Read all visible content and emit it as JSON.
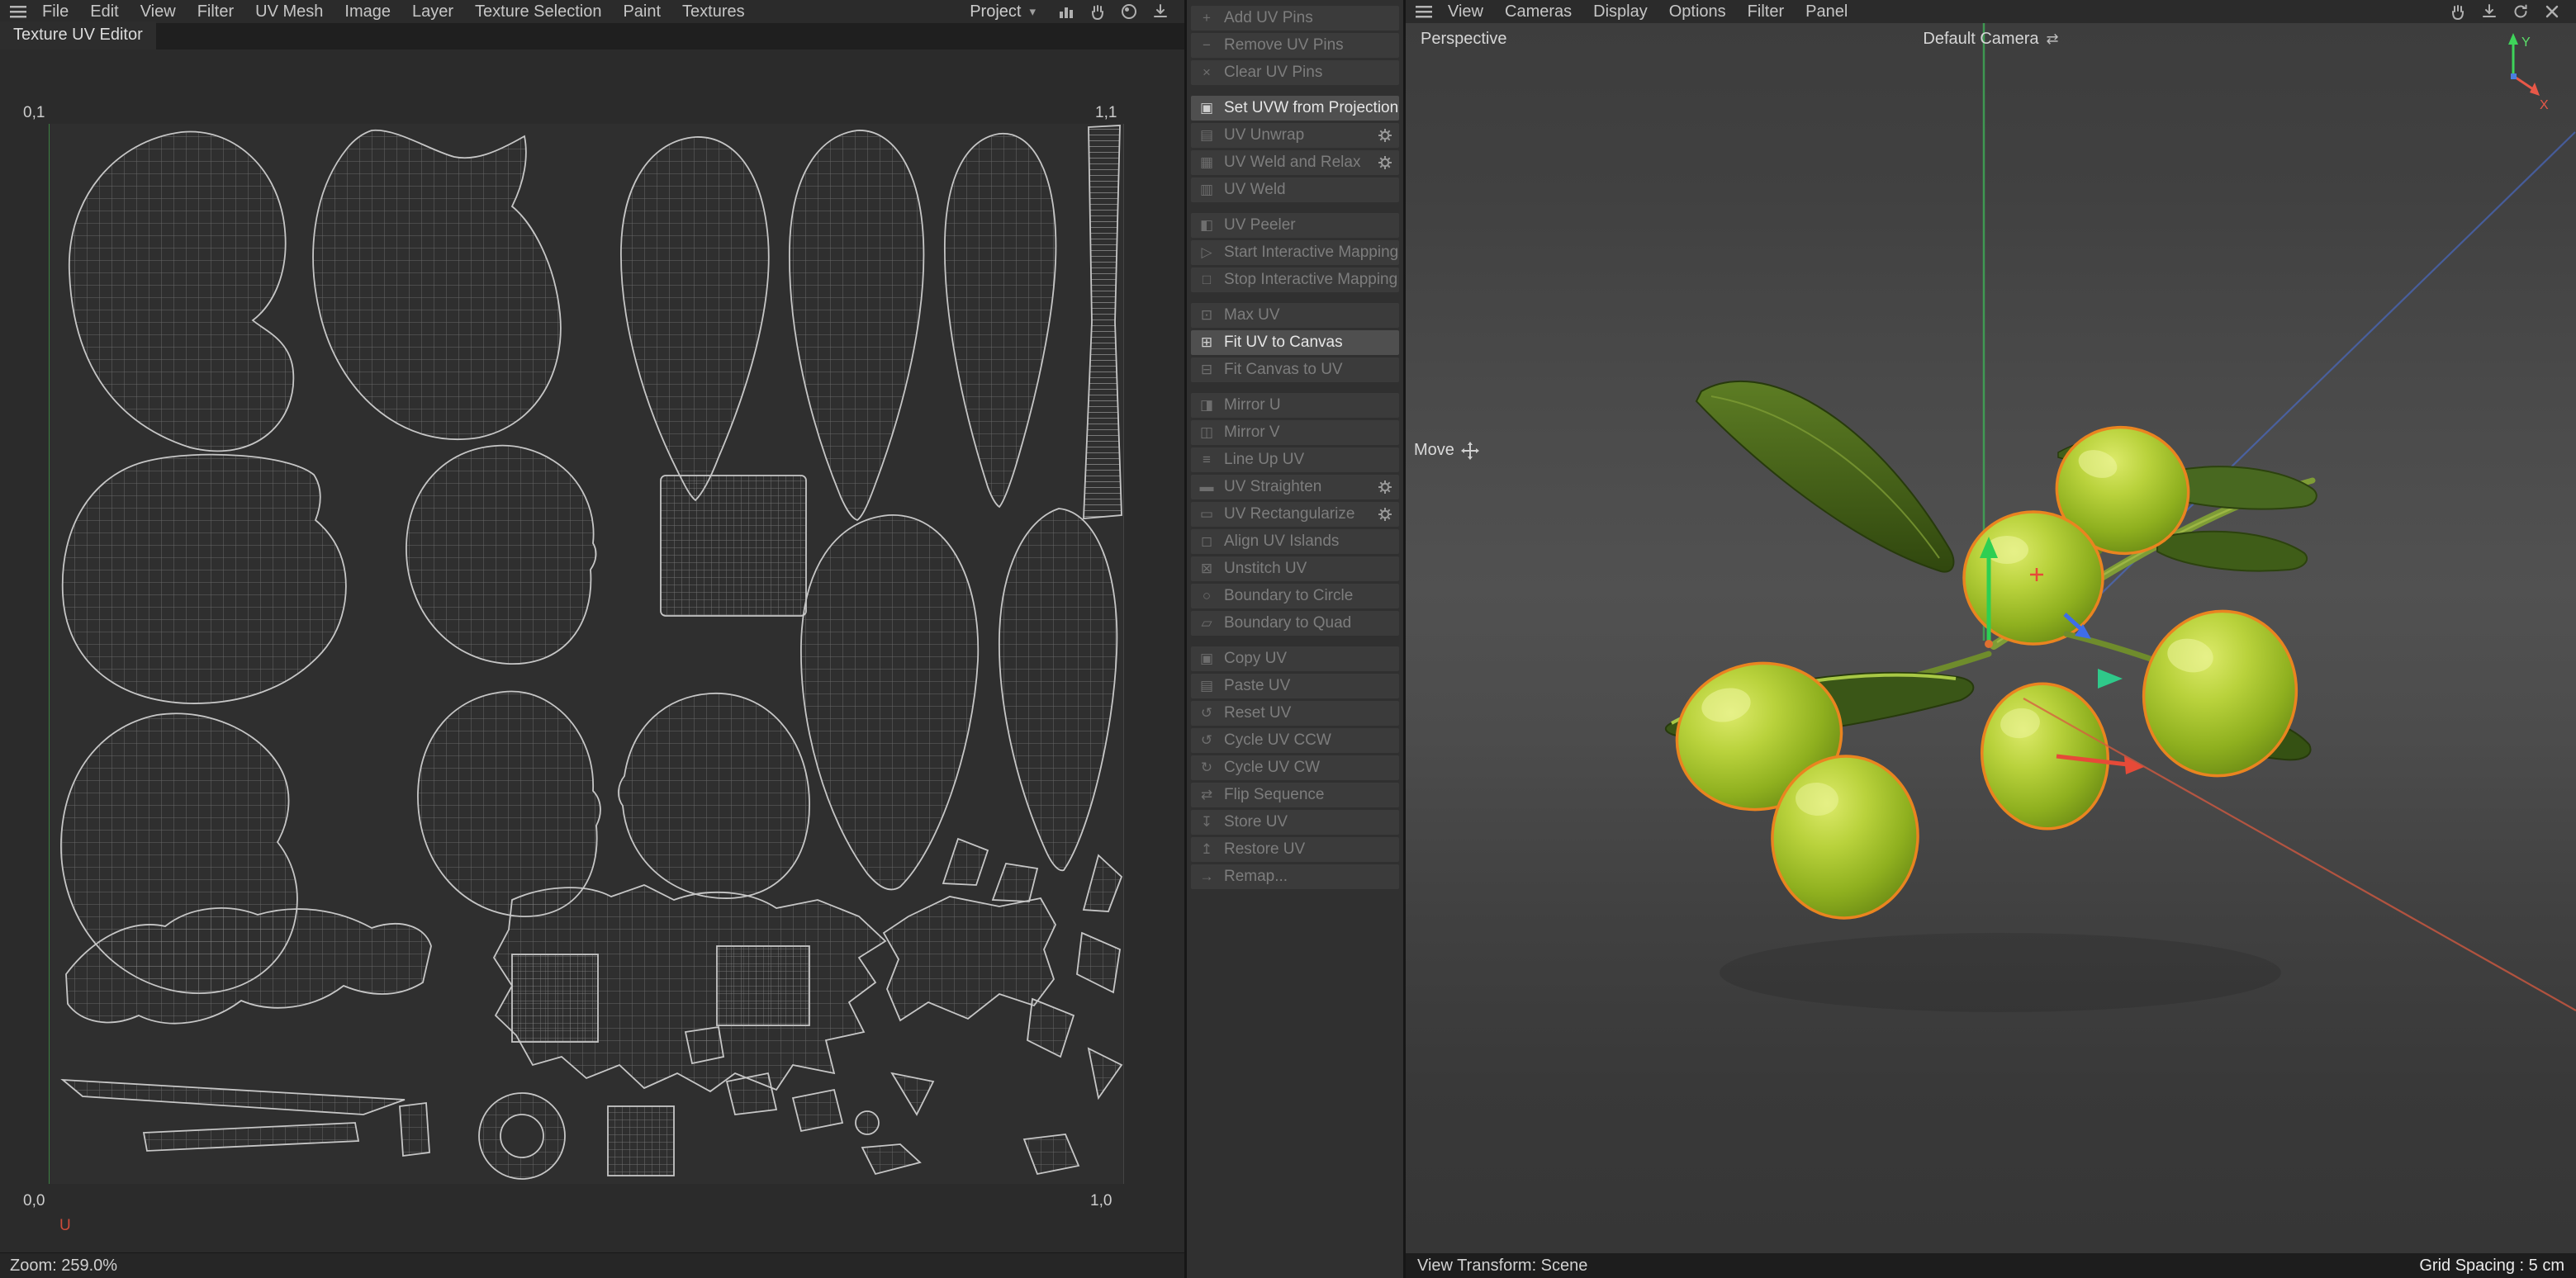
{
  "left_menubar": {
    "items": [
      "File",
      "Edit",
      "View",
      "Filter",
      "UV Mesh",
      "Image",
      "Layer",
      "Texture Selection",
      "Paint",
      "Textures"
    ],
    "project_dropdown": "Project",
    "dropdown_arrow": "▾"
  },
  "right_menubar": {
    "items": [
      "View",
      "Cameras",
      "Display",
      "Options",
      "Filter",
      "Panel"
    ]
  },
  "uv_panel": {
    "tab_title": "Texture UV Editor",
    "corner_top_left": "0,1",
    "corner_top_right": "1,1",
    "corner_bottom_left": "0,0",
    "corner_bottom_right": "1,0",
    "u_axis_label": "U",
    "zoom_status": "Zoom: 259.0%"
  },
  "uv_toolbar": {
    "groups": [
      {
        "items": [
          {
            "label": "Add UV Pins",
            "glyph": "+",
            "enabled": false
          },
          {
            "label": "Remove UV Pins",
            "glyph": "−",
            "enabled": false
          },
          {
            "label": "Clear UV Pins",
            "glyph": "×",
            "enabled": false
          }
        ]
      },
      {
        "items": [
          {
            "label": "Set UVW from Projection",
            "glyph": "▣",
            "enabled": true,
            "highlighted": true,
            "gear": true
          },
          {
            "label": "UV Unwrap",
            "glyph": "▤",
            "enabled": false,
            "gear": true
          },
          {
            "label": "UV Weld and Relax",
            "glyph": "▦",
            "enabled": false,
            "gear": true
          },
          {
            "label": "UV Weld",
            "glyph": "▥",
            "enabled": false
          }
        ]
      },
      {
        "items": [
          {
            "label": "UV Peeler",
            "glyph": "◧",
            "enabled": false
          },
          {
            "label": "Start Interactive Mapping",
            "glyph": "▷",
            "enabled": false
          },
          {
            "label": "Stop Interactive Mapping",
            "glyph": "□",
            "enabled": false
          }
        ]
      },
      {
        "items": [
          {
            "label": "Max UV",
            "glyph": "⊡",
            "enabled": false
          },
          {
            "label": "Fit UV to Canvas",
            "glyph": "⊞",
            "enabled": true,
            "highlighted": true
          },
          {
            "label": "Fit Canvas to UV",
            "glyph": "⊟",
            "enabled": false
          }
        ]
      },
      {
        "items": [
          {
            "label": "Mirror U",
            "glyph": "◨",
            "enabled": false
          },
          {
            "label": "Mirror V",
            "glyph": "◫",
            "enabled": false
          },
          {
            "label": "Line Up UV",
            "glyph": "≡",
            "enabled": false
          },
          {
            "label": "UV Straighten",
            "glyph": "▬",
            "enabled": false,
            "gear": true
          },
          {
            "label": "UV Rectangularize",
            "glyph": "▭",
            "enabled": false,
            "gear": true
          },
          {
            "label": "Align UV Islands",
            "glyph": "◻",
            "enabled": false
          },
          {
            "label": "Unstitch UV",
            "glyph": "⊠",
            "enabled": false
          },
          {
            "label": "Boundary to Circle",
            "glyph": "○",
            "enabled": false
          },
          {
            "label": "Boundary to Quad",
            "glyph": "▱",
            "enabled": false
          }
        ]
      },
      {
        "items": [
          {
            "label": "Copy UV",
            "glyph": "▣",
            "enabled": false
          },
          {
            "label": "Paste UV",
            "glyph": "▤",
            "enabled": false
          },
          {
            "label": "Reset UV",
            "glyph": "↺",
            "enabled": false
          },
          {
            "label": "Cycle UV CCW",
            "glyph": "↺",
            "enabled": false
          },
          {
            "label": "Cycle UV CW",
            "glyph": "↻",
            "enabled": false
          },
          {
            "label": "Flip Sequence",
            "glyph": "⇄",
            "enabled": false
          },
          {
            "label": "Store UV",
            "glyph": "↧",
            "enabled": false
          },
          {
            "label": "Restore UV",
            "glyph": "↥",
            "enabled": false
          },
          {
            "label": "Remap...",
            "glyph": "→",
            "enabled": false
          }
        ]
      }
    ]
  },
  "viewport": {
    "view_label": "Perspective",
    "camera_label": "Default Camera",
    "camera_switch_glyph": "⇄",
    "tool_label": "Move",
    "status_left": "View Transform: Scene",
    "status_right": "Grid Spacing : 5 cm",
    "gizmo": {
      "x": "X",
      "y": "Y"
    }
  },
  "colors": {
    "selection_outline": "#ea8420",
    "axis_green": "#3fae57",
    "axis_red": "#d85a40",
    "axis_blue": "#4a6fd6",
    "olive_green": "#9ab822"
  }
}
